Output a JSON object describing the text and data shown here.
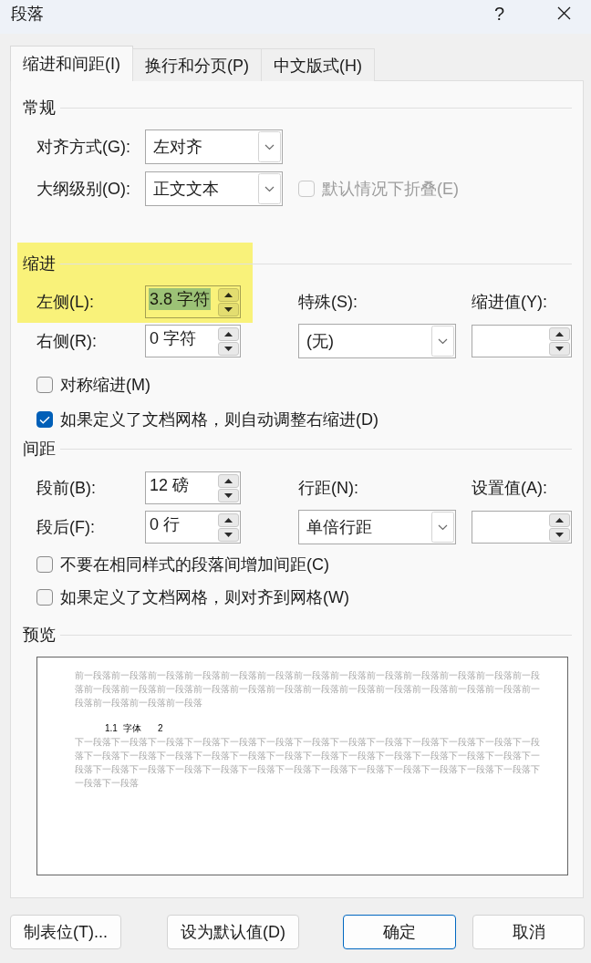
{
  "window": {
    "title": "段落",
    "help_label": "?"
  },
  "tabs": [
    {
      "label": "缩进和间距(I)",
      "selected": true
    },
    {
      "label": "换行和分页(P)",
      "selected": false
    },
    {
      "label": "中文版式(H)",
      "selected": false
    }
  ],
  "general": {
    "heading": "常规",
    "alignment": {
      "label": "对齐方式(G):",
      "value": "左对齐"
    },
    "outline_level": {
      "label": "大纲级别(O):",
      "value": "正文文本"
    },
    "collapse_by_default": {
      "label": "默认情况下折叠(E)",
      "checked": false,
      "disabled": true
    }
  },
  "indentation": {
    "heading": "缩进",
    "highlighted": true,
    "left": {
      "label": "左侧(L):",
      "value": "3.8 字符",
      "value_selected": true
    },
    "right": {
      "label": "右侧(R):",
      "value": "0 字符"
    },
    "special": {
      "label": "特殊(S):",
      "value": "(无)"
    },
    "by": {
      "label": "缩进值(Y):"
    },
    "checkboxes": [
      {
        "label": "对称缩进(M)",
        "checked": false
      },
      {
        "label": "如果定义了文档网格，则自动调整右缩进(D)",
        "checked": true
      }
    ]
  },
  "spacing": {
    "heading": "间距",
    "before": {
      "label": "段前(B):",
      "value": "12 磅"
    },
    "after": {
      "label": "段后(F):",
      "value": "0 行"
    },
    "line_spacing": {
      "label": "行距(N):",
      "value": "单倍行距"
    },
    "at": {
      "label": "设置值(A):"
    },
    "checkboxes": [
      {
        "label": "不要在相同样式的段落间增加间距(C)",
        "checked": false
      },
      {
        "label": "如果定义了文档网格，则对齐到网格(W)",
        "checked": false
      }
    ]
  },
  "preview": {
    "heading": "预览",
    "previous_lines": [
      "前一段落前一段落前一段落前一段落前一段落前一段落前一段落前一段落前一段落前一段落前一段落前一段落前一段",
      "落前一段落前一段落前一段落前一段落前一段落前一段落前一段落前一段落前一段落前一段落前一段落前一段落前一",
      "段落前一段落前一段落前一段落"
    ],
    "sample_heading": {
      "number": "1.1",
      "text": "字体",
      "page": "2"
    },
    "following_lines": [
      "下一段落下一段落下一段落下一段落下一段落下一段落下一段落下一段落下一段落下一段落下一段落下一段落下一段",
      "落下一段落下一段落下一段落下一段落下一段落下一段落下一段落下一段落下一段落下一段落下一段落下一段落下一",
      "段落下一段落下一段落下一段落下一段落下一段落下一段落下一段落下一段落下一段落下一段落下一段落下一段落下",
      "一段落下一段落"
    ]
  },
  "buttons": [
    {
      "label": "制表位(T)...",
      "default": false
    },
    {
      "label": "设为默认值(D)",
      "default": false
    },
    {
      "label": "确定",
      "default": true
    },
    {
      "label": "取消",
      "default": false
    }
  ]
}
